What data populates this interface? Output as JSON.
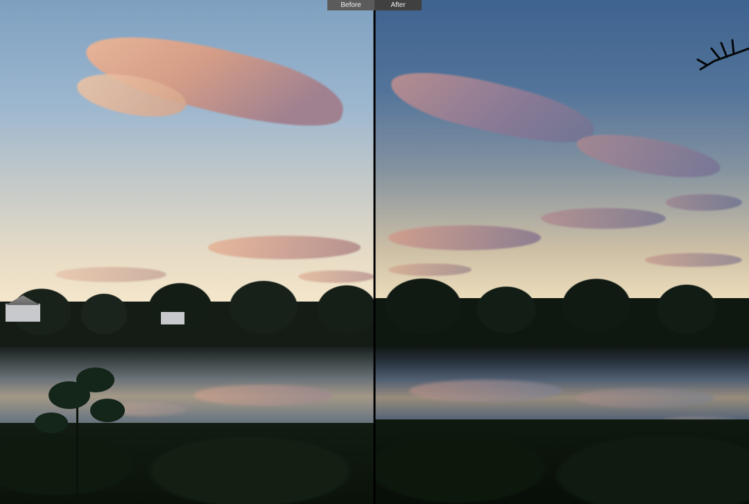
{
  "toggle": {
    "before_label": "Before",
    "after_label": "After"
  }
}
